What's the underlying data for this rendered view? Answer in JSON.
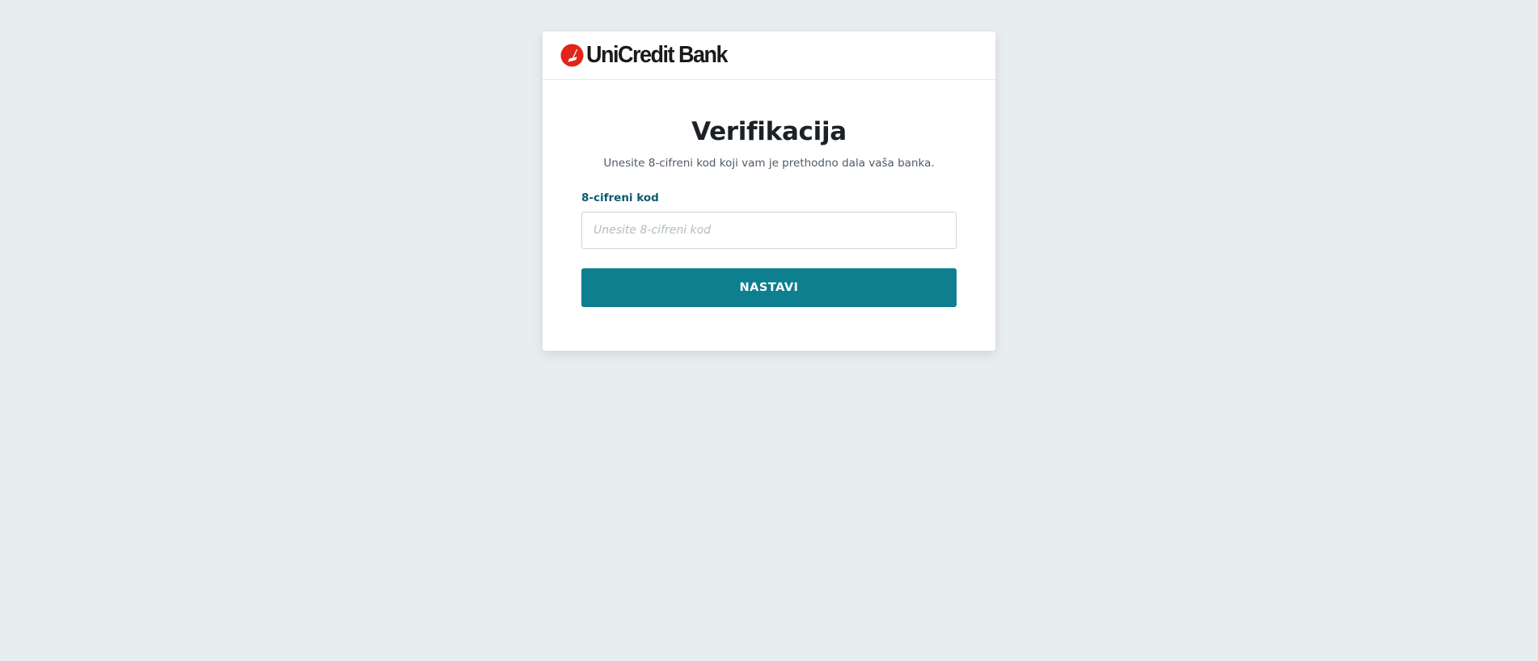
{
  "header": {
    "logo_text": "UniCredit Bank",
    "logo_icon": "unicredit-logo-icon",
    "brand_color": "#e1251b"
  },
  "form": {
    "title": "Verifikacija",
    "subtitle": "Unesite 8-cifreni kod koji vam je prethodno dala vaša banka.",
    "code_label": "8-cifreni kod",
    "code_value": "",
    "code_placeholder": "Unesite 8-cifreni kod",
    "submit_label": "NASTAVI",
    "accent_color": "#0e7f8f"
  }
}
